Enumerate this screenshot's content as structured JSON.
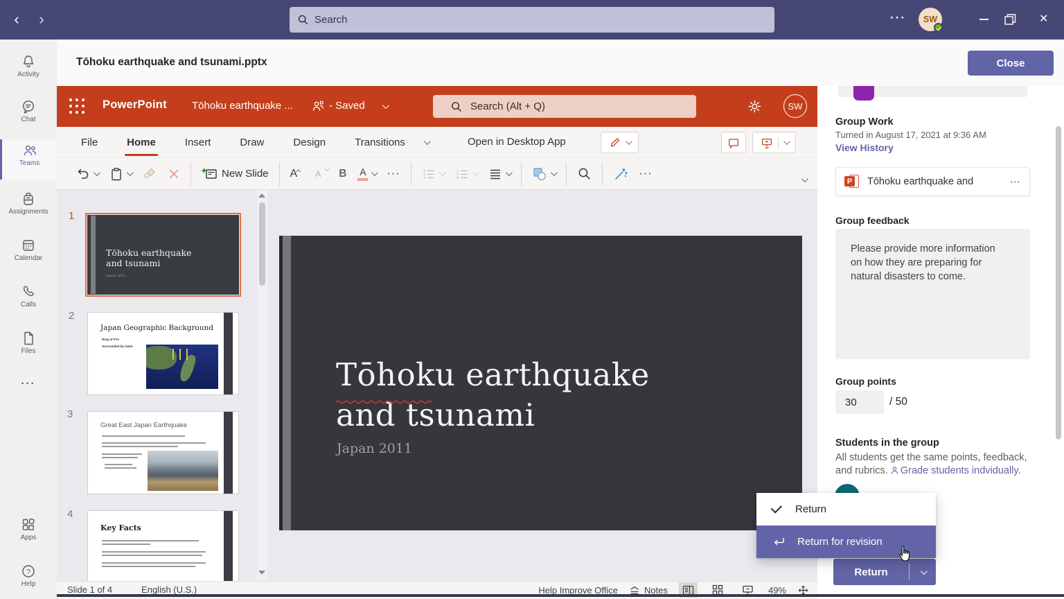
{
  "glyphs": {
    "back": "‹",
    "forward": "›",
    "dots_h": "···",
    "close_x": "✕",
    "question": "?",
    "ellipsis": "⋯",
    "more": "···",
    "grow_font": "A",
    "shrink_font": "A",
    "font_color": "A",
    "bold": "B"
  },
  "teams": {
    "search_placeholder": "Search",
    "avatar_initials": "SW",
    "titlebar": {
      "document_title": "Tōhoku earthquake and tsunami.pptx",
      "close_label": "Close"
    },
    "sidebar": [
      {
        "label": "Activity"
      },
      {
        "label": "Chat"
      },
      {
        "label": "Teams"
      },
      {
        "label": "Assignments"
      },
      {
        "label": "Calendar"
      },
      {
        "label": "Calls"
      },
      {
        "label": "Files"
      },
      {
        "label": "···"
      },
      {
        "label": "Apps"
      },
      {
        "label": "Help"
      }
    ]
  },
  "powerpoint": {
    "app_name": "PowerPoint",
    "doc_name": "Tōhoku earthquake ...",
    "saved_status": "- Saved",
    "search_placeholder": "Search (Alt + Q)",
    "avatar_initials": "SW",
    "tabs": [
      {
        "label": "File"
      },
      {
        "label": "Home"
      },
      {
        "label": "Insert"
      },
      {
        "label": "Draw"
      },
      {
        "label": "Design"
      },
      {
        "label": "Transitions"
      }
    ],
    "open_in_desktop": "Open in Desktop App",
    "new_slide_label": "New Slide",
    "slide": {
      "title_line1": "Tōhoku earthquake",
      "title_line2": "and tsunami",
      "subtitle": "Japan 2011"
    },
    "thumbnails": [
      {
        "number": "1",
        "title": "Tōhoku earthquake and tsunami",
        "subtitle": "Japan 2011"
      },
      {
        "number": "2",
        "title": "Japan Geographic Background",
        "bullet1": "Ring of Fire",
        "bullet2": "Surrounded by water"
      },
      {
        "number": "3",
        "title": "Great East Japan Earthquake"
      },
      {
        "number": "4",
        "title": "Key Facts"
      }
    ],
    "statusbar": {
      "slide_info": "Slide 1 of 4",
      "language": "English (U.S.)",
      "help_improve": "Help Improve Office",
      "notes_label": "Notes",
      "zoom_level": "49%"
    }
  },
  "grading": {
    "assignment_title": "Group Work",
    "turned_in": "Turned in August 17, 2021 at 9:36 AM",
    "view_history": "View History",
    "file_name": "Tōhoku earthquake and",
    "feedback_label": "Group feedback",
    "feedback_text": "Please provide more information on how they are preparing for natural disasters to come.",
    "points_label": "Group points",
    "points_value": "30",
    "points_max": "/ 50",
    "students_label": "Students in the group",
    "students_desc": "All students get the same points, feedback, and rubrics.",
    "grade_individually": "Grade students indvidually.",
    "menu": {
      "item_return": "Return",
      "item_return_revision": "Return for revision"
    },
    "return_button": "Return"
  },
  "colors": {
    "teams_purple": "#464775",
    "accent_purple": "#6264a7",
    "ppt_red": "#c43e1c",
    "selection_orange": "#e0714a",
    "presence_green": "#6bb700"
  }
}
